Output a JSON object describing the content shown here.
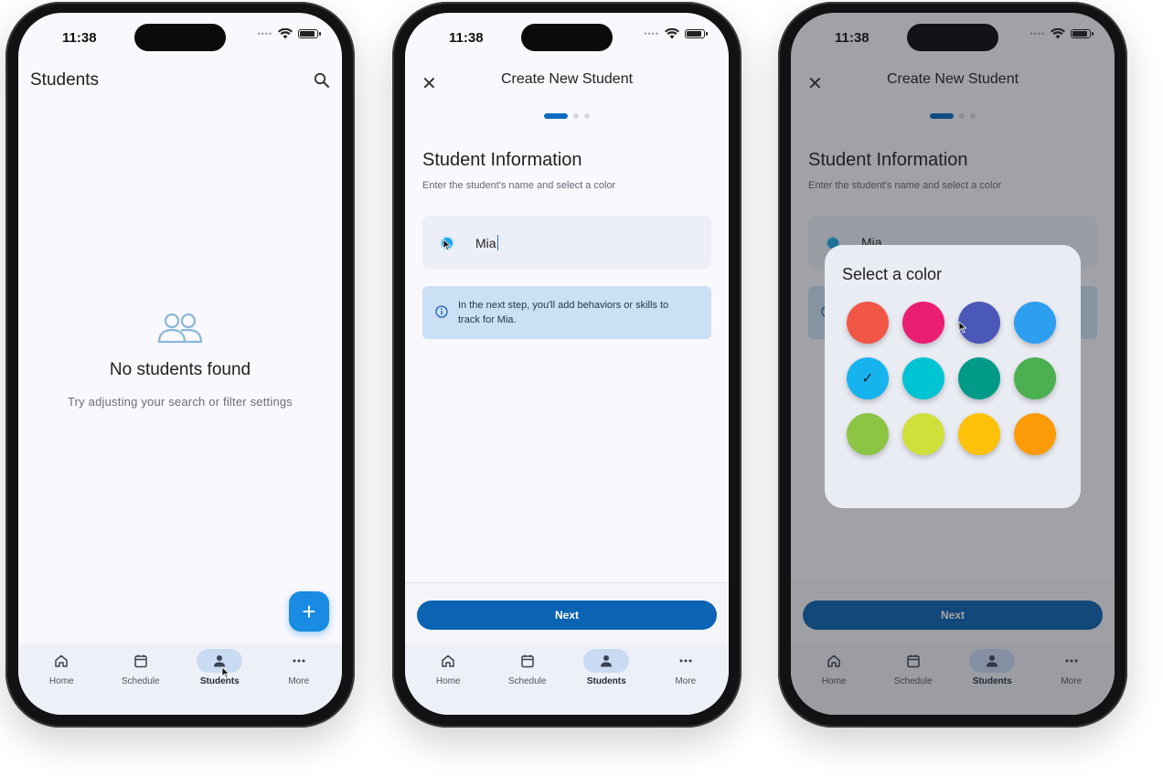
{
  "status": {
    "time": "11:38"
  },
  "phone1": {
    "title": "Students",
    "empty_title": "No students found",
    "empty_subtitle": "Try adjusting your search or filter settings",
    "fab_label": "+"
  },
  "nav": {
    "items": [
      {
        "label": "Home",
        "icon": "home-icon"
      },
      {
        "label": "Schedule",
        "icon": "calendar-icon"
      },
      {
        "label": "Students",
        "icon": "person-icon"
      },
      {
        "label": "More",
        "icon": "more-horizontal-icon"
      }
    ],
    "active": "Students"
  },
  "form": {
    "close": "✕",
    "title": "Create New Student",
    "step": {
      "current": 1,
      "total": 3
    },
    "section_title": "Student Information",
    "section_subtitle": "Enter the student's name and select a color",
    "name_value": "Mia",
    "info_text": "In the next step, you'll add behaviors or skills to track for Mia.",
    "next_label": "Next"
  },
  "dialog": {
    "title": "Select a color",
    "colors": [
      "#f15545",
      "#e91e72",
      "#4a58b8",
      "#2d9ff0",
      "#16b3ef",
      "#00c3d3",
      "#009a88",
      "#4caf50",
      "#8cc443",
      "#cfe03a",
      "#fcc108",
      "#fc9b07"
    ],
    "selected_index": 4,
    "check": "✓"
  },
  "colors": {
    "primary": "#0a63b3",
    "fab": "#1a8be2",
    "info_bg": "#cbe0f4",
    "nav_active_pill": "#c9dbf3"
  }
}
